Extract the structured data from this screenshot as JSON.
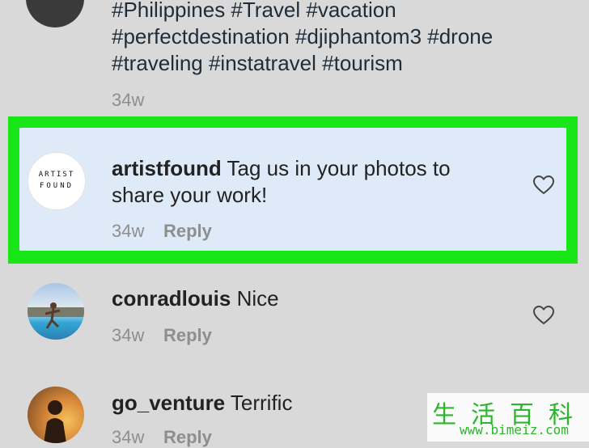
{
  "top_comment": {
    "hashtags_line1": "#Philippines #Travel #vacation",
    "hashtags_line2": "#perfectdestination #djiphantom3 #drone",
    "hashtags_line3": "#traveling #instatravel #tourism",
    "time": "34w"
  },
  "comments": [
    {
      "username": "artistfound",
      "text_line1": " Tag us in your photos to",
      "text_line2": "share your work!",
      "time": "34w",
      "reply_label": "Reply",
      "avatar_text_line1": "ARTIST",
      "avatar_text_line2": "FOUND"
    },
    {
      "username": "conradlouis",
      "text_line1": " Nice",
      "time": "34w",
      "reply_label": "Reply"
    },
    {
      "username": "go_venture",
      "text_line1": " Terrific",
      "time": "34w",
      "reply_label": "Reply"
    }
  ],
  "colors": {
    "highlight_border": "#19e619",
    "highlight_fill": "#deeaf7",
    "background": "#d9d9d9"
  },
  "watermark": {
    "chinese": "生活百科",
    "url": "www.bimeiz.com"
  }
}
